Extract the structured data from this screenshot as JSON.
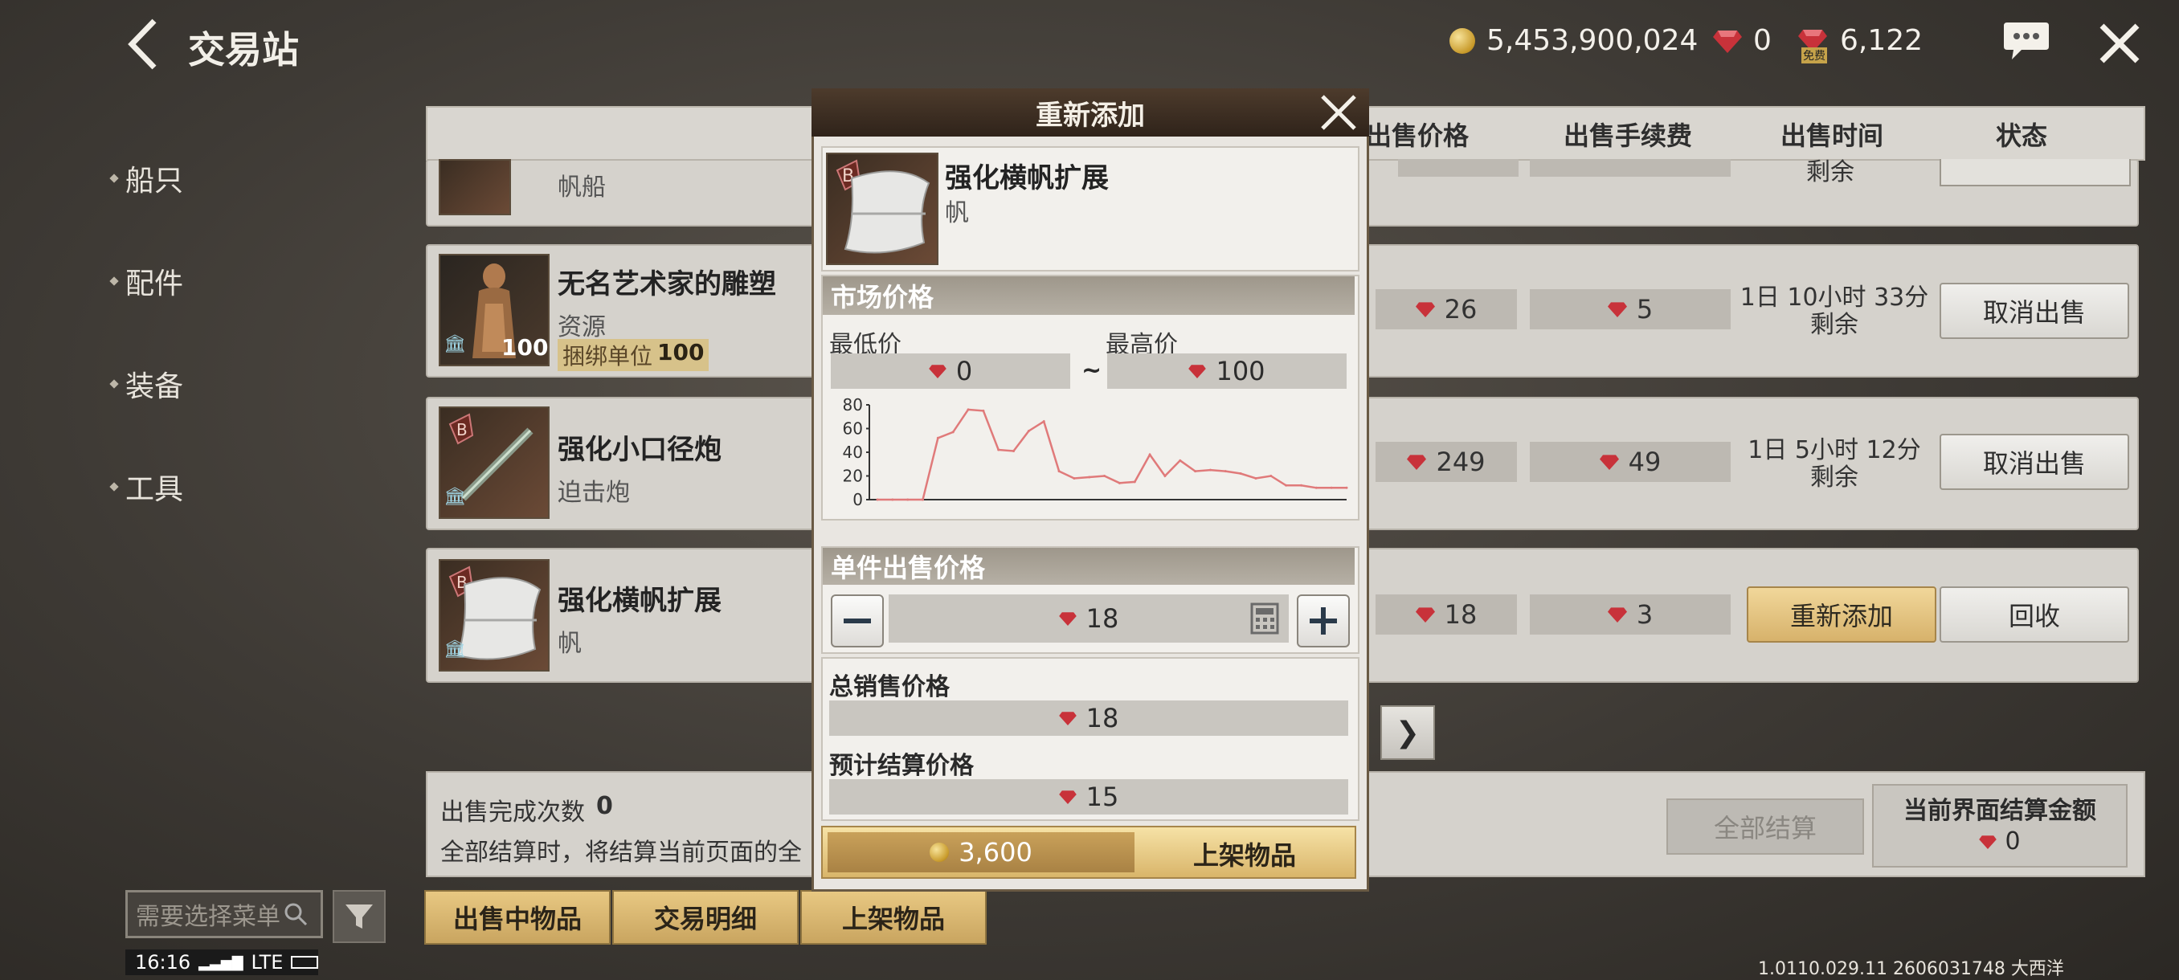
{
  "header": {
    "title": "交易站",
    "gold": "5,453,900,024",
    "gems_paid": "0",
    "gems_free": "6,122",
    "free_tag": "免费"
  },
  "sidebar": {
    "items": [
      {
        "label": "船只"
      },
      {
        "label": "配件"
      },
      {
        "label": "装备"
      },
      {
        "label": "工具"
      }
    ]
  },
  "table": {
    "headers": {
      "sale_price": "出售价格",
      "fee": "出售手续费",
      "time": "出售时间",
      "status": "状态"
    },
    "rows": [
      {
        "name": "",
        "sub": "帆船",
        "price": "",
        "fee": "",
        "time_line2": "剩余"
      },
      {
        "name": "无名艺术家的雕塑",
        "sub": "资源",
        "bundle_label": "捆绑单位",
        "bundle_value": "100",
        "qty": "100",
        "price": "26",
        "fee": "5",
        "time_line1": "1日 10小时 33分",
        "time_line2": "剩余",
        "action": "取消出售"
      },
      {
        "name": "强化小口径炮",
        "sub": "迫击炮",
        "price": "249",
        "fee": "49",
        "time_line1": "1日 5小时 12分",
        "time_line2": "剩余",
        "action": "取消出售"
      },
      {
        "name": "强化横帆扩展",
        "sub": "帆",
        "price": "18",
        "fee": "3",
        "action_primary": "重新添加",
        "action": "回收"
      }
    ]
  },
  "summary": {
    "count_label": "出售完成次数",
    "count_value": "0",
    "note": "全部结算时，将结算当前页面的全",
    "settle_all": "全部结算",
    "page_total_label": "当前界面结算金额",
    "page_total_value": "0",
    "next": "❯"
  },
  "bottom": {
    "search_placeholder": "需要选择菜单",
    "tabs": [
      {
        "label": "出售中物品"
      },
      {
        "label": "交易明细"
      },
      {
        "label": "上架物品"
      }
    ],
    "clock": "16:16",
    "network": "LTE",
    "version": "1.0110.029.11 2606031748 大西洋"
  },
  "modal": {
    "title": "重新添加",
    "item_name": "强化横帆扩展",
    "item_type": "帆",
    "grade": "B",
    "market_label": "市场价格",
    "min_label": "最低价",
    "min_value": "0",
    "tilde": "~",
    "max_label": "最高价",
    "max_value": "100",
    "unit_price_label": "单件出售价格",
    "unit_price": "18",
    "total_label": "总销售价格",
    "total_value": "18",
    "settle_label": "预计结算价格",
    "settle_value": "15",
    "fee_gold": "3,600",
    "list_button": "上架物品"
  },
  "chart_data": {
    "type": "line",
    "y_ticks": [
      "80",
      "60",
      "40",
      "20",
      "0"
    ],
    "ylim": [
      0,
      80
    ],
    "x": [
      0,
      1,
      2,
      3,
      4,
      5,
      6,
      7,
      8,
      9,
      10,
      11,
      12,
      13,
      14,
      15,
      16,
      17,
      18,
      19,
      20,
      21,
      22,
      23,
      24,
      25,
      26,
      27,
      28,
      29,
      30,
      31
    ],
    "values": [
      0,
      0,
      0,
      0,
      52,
      57,
      76,
      75,
      42,
      41,
      58,
      66,
      24,
      18,
      19,
      20,
      14,
      15,
      38,
      20,
      33,
      24,
      25,
      24,
      22,
      18,
      20,
      12,
      12,
      10,
      10,
      10
    ],
    "color": "#e07a7a"
  },
  "colors": {
    "gem": "#c8323a",
    "gold": "#c89a2a"
  }
}
